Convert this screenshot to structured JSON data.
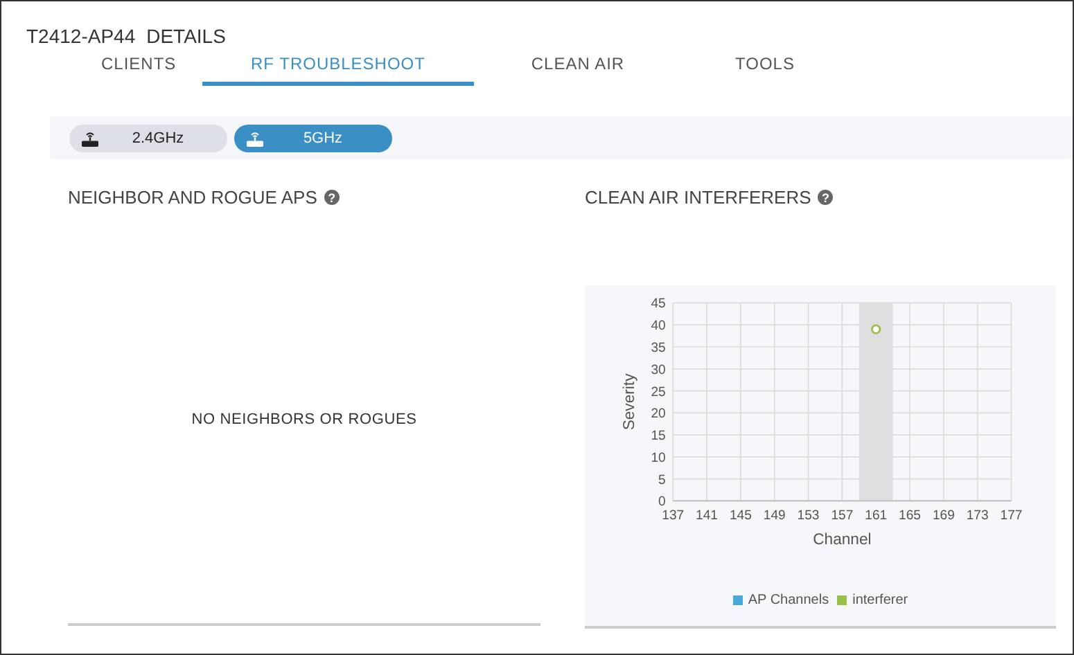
{
  "header": {
    "device": "T2412-AP44",
    "title": "DETAILS"
  },
  "tabs": [
    {
      "label": "CLIENTS",
      "selected": false
    },
    {
      "label": "RF TROUBLESHOOT",
      "selected": true
    },
    {
      "label": "CLEAN AIR",
      "selected": false
    },
    {
      "label": "TOOLS",
      "selected": false
    }
  ],
  "bands": [
    {
      "label": "2.4GHz",
      "selected": false
    },
    {
      "label": "5GHz",
      "selected": true
    }
  ],
  "neighbors": {
    "title": "NEIGHBOR AND ROGUE APS",
    "help": "?",
    "empty_message": "NO NEIGHBORS OR ROGUES"
  },
  "interferers": {
    "title": "CLEAN AIR INTERFERERS",
    "help": "?",
    "chart_data": {
      "type": "scatter",
      "xlabel": "Channel",
      "ylabel": "Severity",
      "x": [
        161
      ],
      "series": [
        {
          "name": "AP Channels",
          "color": "#4aa8d8",
          "values": [
            null
          ]
        },
        {
          "name": "interferer",
          "color": "#9ac04c",
          "values": [
            39
          ]
        }
      ],
      "xlim": [
        137,
        177
      ],
      "ylim": [
        0,
        45
      ],
      "xticks": [
        137,
        141,
        145,
        149,
        153,
        157,
        161,
        165,
        169,
        173,
        177
      ],
      "yticks": [
        0,
        5,
        10,
        15,
        20,
        25,
        30,
        35,
        40,
        45
      ],
      "grid": true,
      "bands": [
        {
          "axis": "x",
          "from": 159,
          "to": 163,
          "color": "#dedede"
        }
      ]
    }
  }
}
